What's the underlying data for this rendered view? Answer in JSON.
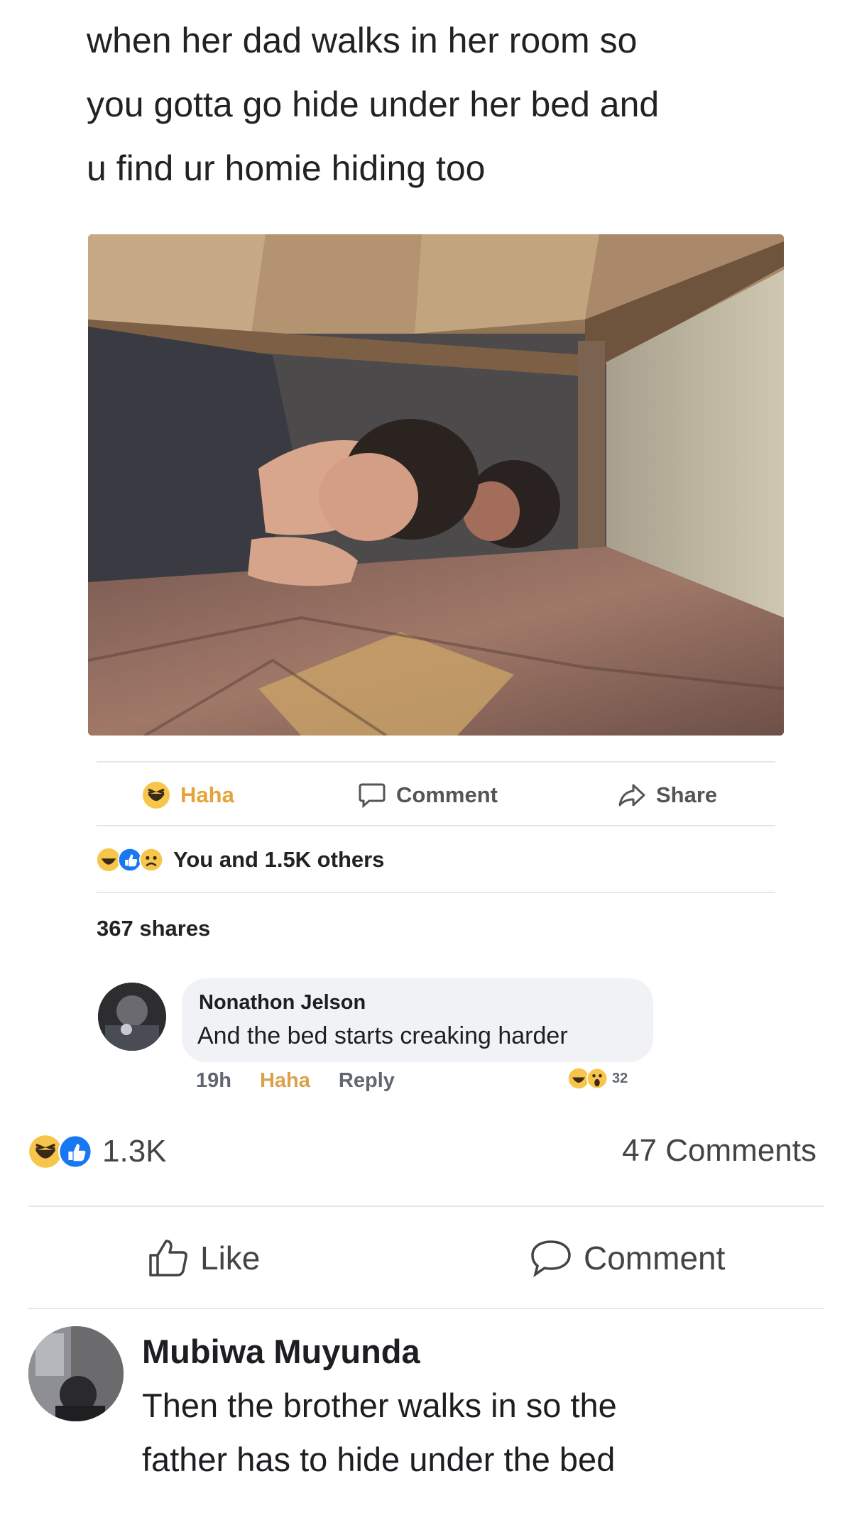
{
  "caption": {
    "line1": "when her dad walks in her room so",
    "line2": "you gotta go hide under her bed and",
    "line3": "u find ur homie hiding too"
  },
  "embedded_post": {
    "actions": {
      "haha_label": "Haha",
      "comment_label": "Comment",
      "share_label": "Share"
    },
    "reactions_text": "You and 1.5K others",
    "shares_text": "367 shares",
    "comment": {
      "author": "Nonathon Jelson",
      "text": "And the bed starts creaking harder",
      "time": "19h",
      "haha_label": "Haha",
      "reply_label": "Reply",
      "reaction_count": "32"
    }
  },
  "outer_post": {
    "reaction_count": "1.3K",
    "comments_count": "47 Comments",
    "like_label": "Like",
    "comment_label": "Comment",
    "comment": {
      "author": "Mubiwa Muyunda",
      "line1": "Then the brother walks in so the",
      "line2": "father has to hide under the bed"
    }
  },
  "colors": {
    "haha_yellow": "#f7c54a",
    "like_blue": "#1877f2",
    "divider": "#e6e6e6"
  },
  "icons": [
    "haha-icon",
    "comment-icon",
    "share-icon",
    "like-icon",
    "wow-icon"
  ]
}
